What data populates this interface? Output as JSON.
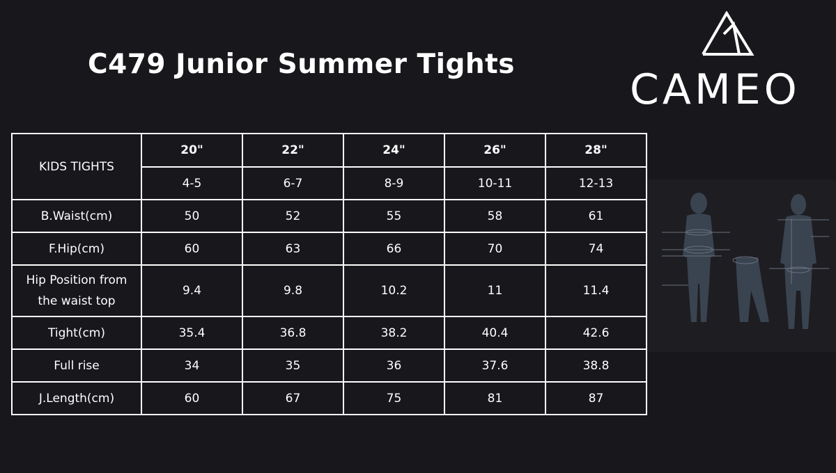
{
  "title": "C479 Junior Summer Tights",
  "logo": {
    "text": "CAMEO",
    "icon": "mountain-logo-icon"
  },
  "figure": {
    "icon": "body-measurement-figures-icon"
  },
  "table": {
    "corner_label": "KIDS TIGHTS",
    "sizes": [
      "20\"",
      "22\"",
      "24\"",
      "26\"",
      "28\""
    ],
    "ages": [
      "4-5",
      "6-7",
      "8-9",
      "10-11",
      "12-13"
    ],
    "rows": [
      {
        "label": "B.Waist(cm)",
        "values": [
          "50",
          "52",
          "55",
          "58",
          "61"
        ]
      },
      {
        "label": "F.Hip(cm)",
        "values": [
          "60",
          "63",
          "66",
          "70",
          "74"
        ]
      },
      {
        "label": "Hip Position from the waist top",
        "values": [
          "9.4",
          "9.8",
          "10.2",
          "11",
          "11.4"
        ]
      },
      {
        "label": "Tight(cm)",
        "values": [
          "35.4",
          "36.8",
          "38.2",
          "40.4",
          "42.6"
        ]
      },
      {
        "label": "Full rise",
        "values": [
          "34",
          "35",
          "36",
          "37.6",
          "38.8"
        ]
      },
      {
        "label": "J.Length(cm)",
        "values": [
          "60",
          "67",
          "75",
          "81",
          "87"
        ]
      }
    ]
  },
  "colors": {
    "background": "#18171c",
    "text": "#ffffff",
    "figure": "#3f4a56"
  }
}
